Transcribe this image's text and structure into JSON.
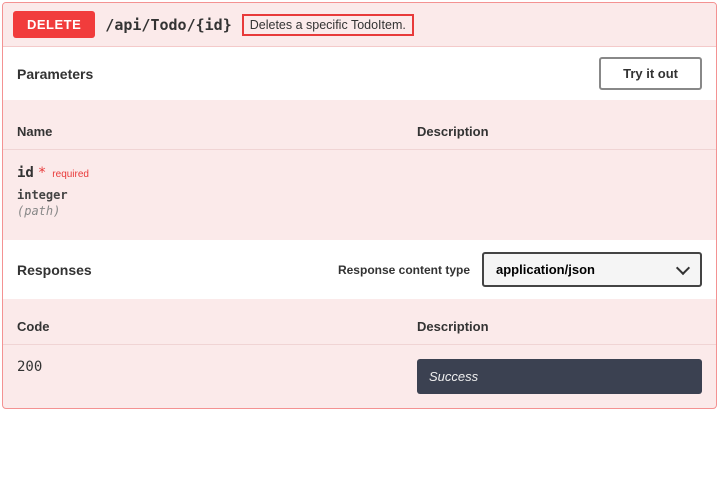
{
  "operation": {
    "method": "DELETE",
    "path": "/api/Todo/{id}",
    "summary": "Deletes a specific TodoItem."
  },
  "sections": {
    "parameters_title": "Parameters",
    "try_it_out": "Try it out",
    "responses_title": "Responses",
    "response_content_type_label": "Response content type"
  },
  "headers": {
    "name": "Name",
    "description": "Description",
    "code": "Code"
  },
  "parameters": [
    {
      "name": "id",
      "required_label": "required",
      "type": "integer",
      "in": "(path)"
    }
  ],
  "responses": {
    "content_type": "application/json",
    "items": [
      {
        "code": "200",
        "description": "Success"
      }
    ]
  }
}
